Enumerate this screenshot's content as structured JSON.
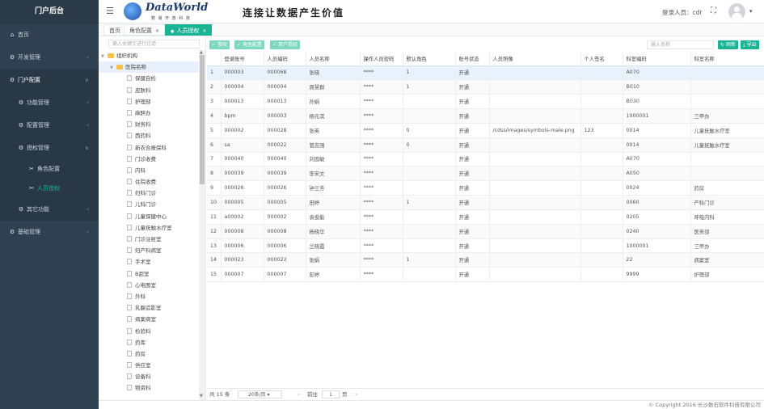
{
  "sidebar": {
    "brand": "门户后台",
    "items": [
      {
        "label": "首页",
        "icon": "home-icon",
        "glyph": "⌂",
        "level": 0,
        "has_children": false
      },
      {
        "label": "开发管理",
        "icon": "gear-icon",
        "glyph": "⚙",
        "level": 0,
        "has_children": true
      },
      {
        "label": "门户配置",
        "icon": "gear-icon",
        "glyph": "⚙",
        "level": 0,
        "has_children": true,
        "open": true
      },
      {
        "label": "功能管理",
        "icon": "gear-icon",
        "glyph": "⚙",
        "level": 1,
        "has_children": true
      },
      {
        "label": "配置管理",
        "icon": "gear-icon",
        "glyph": "⚙",
        "level": 1,
        "has_children": true
      },
      {
        "label": "授权管理",
        "icon": "gear-icon",
        "glyph": "⚙",
        "level": 1,
        "has_children": true,
        "open": true
      },
      {
        "label": "角色配置",
        "icon": "tools-icon",
        "glyph": "✂",
        "level": 2,
        "has_children": false
      },
      {
        "label": "人员授权",
        "icon": "tools-icon",
        "glyph": "✂",
        "level": 2,
        "has_children": false,
        "active": true
      },
      {
        "label": "其它功能",
        "icon": "gear-icon",
        "glyph": "⚙",
        "level": 1,
        "has_children": true
      },
      {
        "label": "基础管理",
        "icon": "gear-icon",
        "glyph": "⚙",
        "level": 0,
        "has_children": true
      }
    ]
  },
  "header": {
    "logo_text": "DataWorld",
    "logo_sub": "数 易 开 放 科 技",
    "slogan": "连接让数据产生价值",
    "login_label": "登录人员：cdr"
  },
  "tabs": [
    {
      "label": "首页",
      "active": false
    },
    {
      "label": "角色配置",
      "active": false,
      "closable": true
    },
    {
      "label": "人员授权",
      "active": true,
      "closable": true
    }
  ],
  "tree": {
    "search_placeholder": "输入关键字进行过滤",
    "root": "组织机构",
    "group": "医院名称",
    "nodes": [
      "保健自检",
      "皮肤科",
      "护理部",
      "麻醉办",
      "财务科",
      "西药科",
      "新农合报保科",
      "门诊收费",
      "内科",
      "住院收费",
      "妇科门诊",
      "儿科门诊",
      "儿童保健中心",
      "儿童抚触水疗室",
      "门诊注射室",
      "妇产科病室",
      "手术室",
      "B超室",
      "心电图室",
      "外科",
      "乳腺造影室",
      "病案病室",
      "检验科",
      "药库",
      "药房",
      "供应室",
      "设备科",
      "物资科"
    ]
  },
  "toolbar": {
    "buttons": [
      "授权",
      "角色配置",
      "用户授权"
    ],
    "role_search_placeholder": "输入名称",
    "refresh_label": "刷新",
    "export_label": "导出"
  },
  "table": {
    "columns": [
      "",
      "登录账号",
      "人员编码",
      "人员名称",
      "操作人员密码",
      "默认角色",
      "账号状态",
      "人员照像",
      "个人签名",
      "科室编码",
      "科室名称"
    ],
    "rows": [
      [
        "1",
        "000003",
        "000068",
        "张晓",
        "****",
        "1",
        "开通",
        "",
        "",
        "A070",
        ""
      ],
      [
        "2",
        "000004",
        "000004",
        "周慧群",
        "****",
        "1",
        "开通",
        "",
        "",
        "B010",
        ""
      ],
      [
        "3",
        "000013",
        "000013",
        "孙娟",
        "****",
        "",
        "开通",
        "",
        "",
        "B030",
        ""
      ],
      [
        "4",
        "bpm",
        "000003",
        "杨元滨",
        "****",
        "",
        "开通",
        "",
        "",
        "1000001",
        "三甲办"
      ],
      [
        "5",
        "000002",
        "000028",
        "张英",
        "****",
        "0",
        "开通",
        "/cdss/images/symbols-male.png",
        "123",
        "0014",
        "儿童抚触水疗室"
      ],
      [
        "6",
        "sa",
        "000022",
        "管志强",
        "****",
        "0",
        "开通",
        "",
        "",
        "0014",
        "儿童抚触水疗室"
      ],
      [
        "7",
        "000040",
        "000040",
        "刘国敏",
        "****",
        "",
        "开通",
        "",
        "",
        "A070",
        ""
      ],
      [
        "8",
        "000039",
        "000039",
        "李宋文",
        "****",
        "",
        "开通",
        "",
        "",
        "A050",
        ""
      ],
      [
        "9",
        "000026",
        "000026",
        "钟兰芳",
        "****",
        "",
        "开通",
        "",
        "",
        "0024",
        "药房"
      ],
      [
        "10",
        "000005",
        "000005",
        "田婷",
        "****",
        "1",
        "开通",
        "",
        "",
        "0060",
        "产科门诊"
      ],
      [
        "11",
        "a00002",
        "000002",
        "袁俊能",
        "****",
        "",
        "开通",
        "",
        "",
        "0205",
        "呼吸内科"
      ],
      [
        "12",
        "000008",
        "000008",
        "杨晓华",
        "****",
        "",
        "开通",
        "",
        "",
        "0240",
        "医务部"
      ],
      [
        "13",
        "000006",
        "000006",
        "兰晓霞",
        "****",
        "",
        "开通",
        "",
        "",
        "1000001",
        "三甲办"
      ],
      [
        "14",
        "000023",
        "000023",
        "张娟",
        "****",
        "1",
        "开通",
        "",
        "",
        "22",
        "病案室"
      ],
      [
        "15",
        "000007",
        "000007",
        "彭婷",
        "****",
        "",
        "开通",
        "",
        "",
        "9999",
        "护理部"
      ]
    ]
  },
  "pager": {
    "total": "共 15 条",
    "page_size": "20条/页",
    "goto": "前往",
    "page": "1",
    "page_unit": "页"
  },
  "footer": "© Copyright 2016 长沙数石软件科技有限公司",
  "colors": {
    "accent": "#1ab394",
    "sidebar": "#2f4050",
    "highlight_row": "#e7f2fc"
  }
}
